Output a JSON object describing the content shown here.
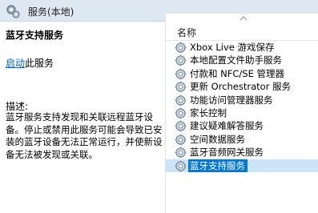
{
  "window": {
    "title": "服务(本地)"
  },
  "detail": {
    "service_name": "蓝牙支持服务",
    "start_link": "启动",
    "start_suffix": "此服务",
    "description_label": "描述:",
    "description": "蓝牙服务支持发现和关联远程蓝牙设备。停止或禁用此服务可能会导致已安装的蓝牙设备无法正常运行，并使新设备无法被发现或关联。"
  },
  "list": {
    "column_header": "名称",
    "items": [
      "Xbox Live 游戏保存",
      "本地配置文件助手服务",
      "付款和 NFC/SE 管理器",
      "更新 Orchestrator 服务",
      "功能访问管理器服务",
      "家长控制",
      "建议疑难解答服务",
      "空间数据服务",
      "蓝牙音频网关服务",
      "蓝牙支持服务"
    ],
    "selected": "蓝牙支持服务"
  },
  "colors": {
    "header_bg": "#dde8f3",
    "link": "#0066cc",
    "selection": "#0078d7"
  },
  "icons": {
    "header": "services-gear-icon",
    "row": "gear-icon"
  }
}
